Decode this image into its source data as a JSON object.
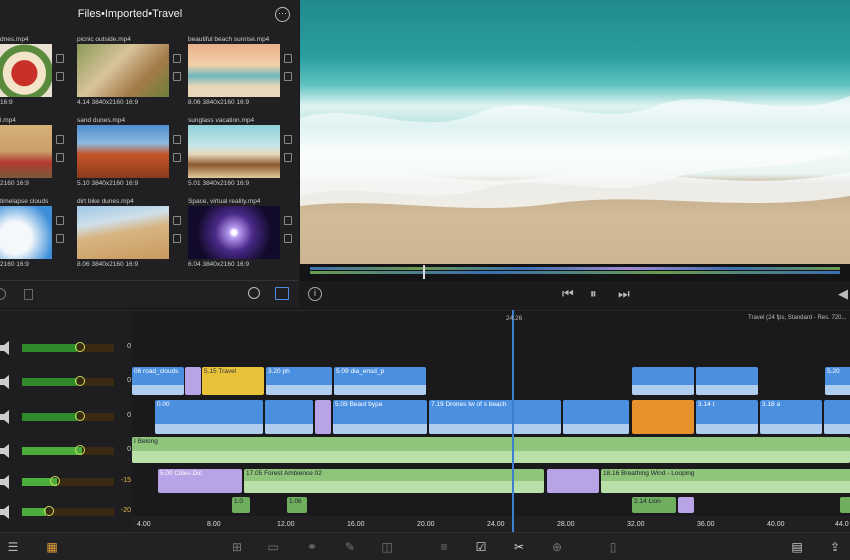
{
  "browser": {
    "title": "Files•Imported•Travel",
    "clips": [
      {
        "name": "dnes.mp4",
        "meta": "16:9"
      },
      {
        "name": "picnic outside.mp4",
        "meta": "4.14 3840x2160 16:9"
      },
      {
        "name": "beautiful beach sunrise.mp4",
        "meta": "8.06 3840x2160 16:9"
      },
      {
        "name": "l.mp4",
        "meta": "2160 16:9"
      },
      {
        "name": "sand dunes.mp4",
        "meta": "5.10 3840x2160 16:9"
      },
      {
        "name": "sunglass vacation.mp4",
        "meta": "5.01 3840x2160 16:9"
      },
      {
        "name": "timelapse clouds",
        "meta": "2160 16:9"
      },
      {
        "name": "dirt bike dunes.mp4",
        "meta": "8.06 3840x2160 16:9"
      },
      {
        "name": "Space, virtual reality.mp4",
        "meta": "6.04 3840x2160 16:9"
      }
    ]
  },
  "timeline": {
    "playhead_label": "24.26",
    "project_info": "Travel (24 fps, Standard - Res. 720...",
    "tracks": [
      {
        "db": "0"
      },
      {
        "db": "0"
      },
      {
        "db": "0"
      },
      {
        "db": "0"
      },
      {
        "db": "-15"
      },
      {
        "db": "-20"
      }
    ],
    "clips": {
      "c1": "06 road_clouds",
      "c2": "5.15 Travel",
      "c3": "3.20 ph",
      "c4": "5.09 dia_ensd_p",
      "c5": "0.00",
      "c6": "5.09 Beaut bypa",
      "c7": "7.19 Drones",
      "c8": "tw of s beach",
      "c9": "3.14 t",
      "c10": "3.18 a",
      "c11": "5.20",
      "a1": "I Belong",
      "a2": "5.00 Cities Dic",
      "a3": "17.05 Forest Ambience 02",
      "a4": "18.16 Breathing Wind - Looping",
      "a5": "1.0",
      "a6": "1.06",
      "a7": "2.14 Lion"
    },
    "ruler": [
      "4.00",
      "8.00",
      "12.00",
      "16.00",
      "20.00",
      "24.00",
      "28.00",
      "32.00",
      "36.00",
      "40.00",
      "44.0"
    ]
  }
}
